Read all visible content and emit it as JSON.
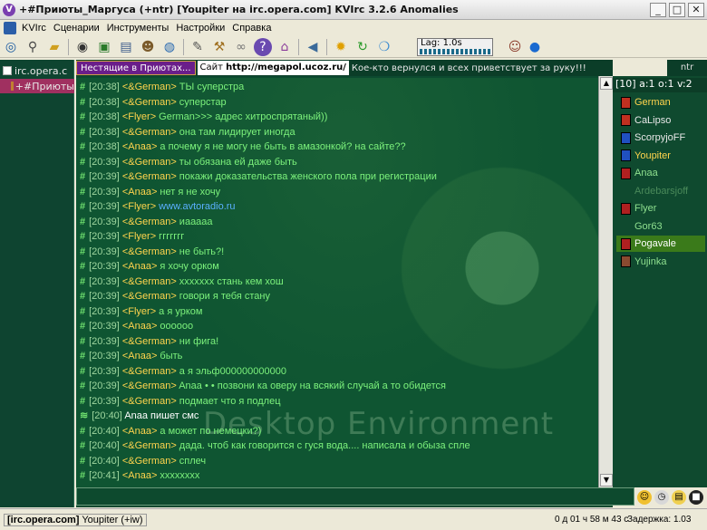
{
  "window": {
    "title": "+#Приюты_Маргуса (+ntr) [Youpiter на irc.opera.com] KVIrc 3.2.6 Anomalies",
    "controls": [
      "_",
      "□",
      "✕"
    ]
  },
  "menu": [
    "KVIrc",
    "Сценарии",
    "Инструменты",
    "Настройки",
    "Справка"
  ],
  "toolbar": {
    "lag_label": "Lag: 1.0s"
  },
  "tree": {
    "server": "irc.opera.c",
    "channel": "+#Приюты"
  },
  "topic": {
    "channel": "Нестящие в Приютах...",
    "site_label": "Сайт",
    "url": "http://megapol.ucoz.ru/",
    "rest": "Кое-кто вернулся и всех приветствует за руку!!!",
    "modes": "ntr"
  },
  "chat": [
    {
      "ts": "[20:38]",
      "nick": "<&German>",
      "msg": " ТЫ суперстра"
    },
    {
      "ts": "[20:38]",
      "nick": "<&German>",
      "msg": " суперстар"
    },
    {
      "ts": "[20:38]",
      "nick": "<Flyer>",
      "msg": " German>>> адрес хитроспрятаный))"
    },
    {
      "ts": "[20:38]",
      "nick": "<&German>",
      "msg": " она там лидирует иногда"
    },
    {
      "ts": "[20:38]",
      "nick": "<Anaa>",
      "msg": " а почему я не могу не быть в амазонкой? на сайте??"
    },
    {
      "ts": "[20:39]",
      "nick": "<&German>",
      "msg": " ты обязана ей даже быть"
    },
    {
      "ts": "[20:39]",
      "nick": "<&German>",
      "msg": " покажи доказательства женского пола при регистрации"
    },
    {
      "ts": "[20:39]",
      "nick": "<Anaa>",
      "msg": " нет я не хочу"
    },
    {
      "ts": "[20:39]",
      "nick": "<Flyer>",
      "msg": " www.avtoradio.ru"
    },
    {
      "ts": "[20:39]",
      "nick": "<&German>",
      "msg": " иааааа"
    },
    {
      "ts": "[20:39]",
      "nick": "<Flyer>",
      "msg": " ггггггг"
    },
    {
      "ts": "[20:39]",
      "nick": "<&German>",
      "msg": " не быть?!"
    },
    {
      "ts": "[20:39]",
      "nick": "<Anaa>",
      "msg": " я хочу орком"
    },
    {
      "ts": "[20:39]",
      "nick": "<&German>",
      "msg": " ххххххх стань кем хош"
    },
    {
      "ts": "[20:39]",
      "nick": "<&German>",
      "msg": " говори я тебя стану"
    },
    {
      "ts": "[20:39]",
      "nick": "<Flyer>",
      "msg": " а я урком"
    },
    {
      "ts": "[20:39]",
      "nick": "<Anaa>",
      "msg": " оооооо"
    },
    {
      "ts": "[20:39]",
      "nick": "<&German>",
      "msg": " ни фига!"
    },
    {
      "ts": "[20:39]",
      "nick": "<Anaa>",
      "msg": " быть"
    },
    {
      "ts": "[20:39]",
      "nick": "<&German>",
      "msg": " а я эльф000000000000"
    },
    {
      "ts": "[20:39]",
      "nick": "<&German>",
      "msg": " Anaa • •  позвони ка оверу на всякий случай а то обидется"
    },
    {
      "ts": "[20:39]",
      "nick": "<&German>",
      "msg": " подмает что я подлец"
    },
    {
      "ts": "[20:40]",
      "nick": "",
      "msg": "Anaa пишет смс"
    },
    {
      "ts": "[20:40]",
      "nick": "<Anaa>",
      "msg": " а может по немецки?)"
    },
    {
      "ts": "[20:40]",
      "nick": "<&German>",
      "msg": " дада. чтоб как говорится с гуся вода.... написала и обыза спле"
    },
    {
      "ts": "[20:40]",
      "nick": "<&German>",
      "msg": " сплеч"
    },
    {
      "ts": "[20:41]",
      "nick": "<Anaa>",
      "msg": " xxxxxxxx"
    }
  ],
  "watermark": "Desktop Environment",
  "users": {
    "header": "[10] a:1 o:1 v:2",
    "list": [
      {
        "name": "German",
        "color": "#ffd44d",
        "badge": "#c03020"
      },
      {
        "name": "CaLipso",
        "color": "#e8e8e8",
        "badge": "#c03020"
      },
      {
        "name": "ScorpyjoFF",
        "color": "#e8e8e8",
        "badge": "#2050c0"
      },
      {
        "name": "Youpiter",
        "color": "#ffd44d",
        "badge": "#2050c0"
      },
      {
        "name": "Anaa",
        "color": "#8fe08f",
        "badge": "#b02020"
      },
      {
        "name": "Ardebarsjoff",
        "color": "#4a8a5a",
        "badge": ""
      },
      {
        "name": "Flyer",
        "color": "#8fe08f",
        "badge": "#b02020"
      },
      {
        "name": "Gor63",
        "color": "#8fe08f",
        "badge": ""
      },
      {
        "name": "Pogavale",
        "color": "#ffffff",
        "badge": "#b02020"
      },
      {
        "name": "Yujinka",
        "color": "#8fe08f",
        "badge": "#8a4a30"
      }
    ]
  },
  "status": {
    "server": "[irc.opera.com]",
    "nick": "Youpiter",
    "mode": "(+iw)",
    "uptime": "0 д 01 ч 58 м 43 с",
    "lag": "Задержка: 1.03"
  }
}
